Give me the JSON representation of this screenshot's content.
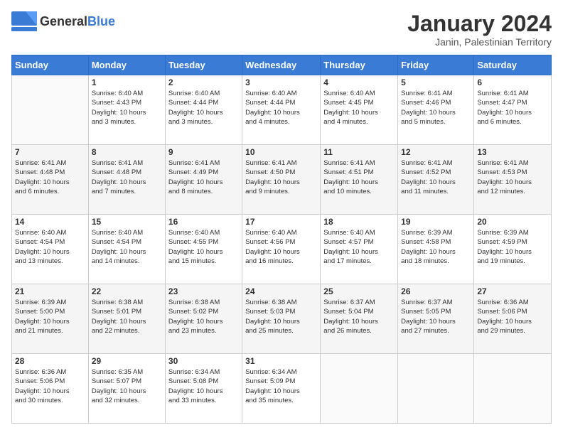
{
  "header": {
    "logo_general": "General",
    "logo_blue": "Blue",
    "title": "January 2024",
    "subtitle": "Janin, Palestinian Territory"
  },
  "days_of_week": [
    "Sunday",
    "Monday",
    "Tuesday",
    "Wednesday",
    "Thursday",
    "Friday",
    "Saturday"
  ],
  "weeks": [
    [
      {
        "day": "",
        "info": ""
      },
      {
        "day": "1",
        "info": "Sunrise: 6:40 AM\nSunset: 4:43 PM\nDaylight: 10 hours\nand 3 minutes."
      },
      {
        "day": "2",
        "info": "Sunrise: 6:40 AM\nSunset: 4:44 PM\nDaylight: 10 hours\nand 3 minutes."
      },
      {
        "day": "3",
        "info": "Sunrise: 6:40 AM\nSunset: 4:44 PM\nDaylight: 10 hours\nand 4 minutes."
      },
      {
        "day": "4",
        "info": "Sunrise: 6:40 AM\nSunset: 4:45 PM\nDaylight: 10 hours\nand 4 minutes."
      },
      {
        "day": "5",
        "info": "Sunrise: 6:41 AM\nSunset: 4:46 PM\nDaylight: 10 hours\nand 5 minutes."
      },
      {
        "day": "6",
        "info": "Sunrise: 6:41 AM\nSunset: 4:47 PM\nDaylight: 10 hours\nand 6 minutes."
      }
    ],
    [
      {
        "day": "7",
        "info": "Sunrise: 6:41 AM\nSunset: 4:48 PM\nDaylight: 10 hours\nand 6 minutes."
      },
      {
        "day": "8",
        "info": "Sunrise: 6:41 AM\nSunset: 4:48 PM\nDaylight: 10 hours\nand 7 minutes."
      },
      {
        "day": "9",
        "info": "Sunrise: 6:41 AM\nSunset: 4:49 PM\nDaylight: 10 hours\nand 8 minutes."
      },
      {
        "day": "10",
        "info": "Sunrise: 6:41 AM\nSunset: 4:50 PM\nDaylight: 10 hours\nand 9 minutes."
      },
      {
        "day": "11",
        "info": "Sunrise: 6:41 AM\nSunset: 4:51 PM\nDaylight: 10 hours\nand 10 minutes."
      },
      {
        "day": "12",
        "info": "Sunrise: 6:41 AM\nSunset: 4:52 PM\nDaylight: 10 hours\nand 11 minutes."
      },
      {
        "day": "13",
        "info": "Sunrise: 6:41 AM\nSunset: 4:53 PM\nDaylight: 10 hours\nand 12 minutes."
      }
    ],
    [
      {
        "day": "14",
        "info": "Sunrise: 6:40 AM\nSunset: 4:54 PM\nDaylight: 10 hours\nand 13 minutes."
      },
      {
        "day": "15",
        "info": "Sunrise: 6:40 AM\nSunset: 4:54 PM\nDaylight: 10 hours\nand 14 minutes."
      },
      {
        "day": "16",
        "info": "Sunrise: 6:40 AM\nSunset: 4:55 PM\nDaylight: 10 hours\nand 15 minutes."
      },
      {
        "day": "17",
        "info": "Sunrise: 6:40 AM\nSunset: 4:56 PM\nDaylight: 10 hours\nand 16 minutes."
      },
      {
        "day": "18",
        "info": "Sunrise: 6:40 AM\nSunset: 4:57 PM\nDaylight: 10 hours\nand 17 minutes."
      },
      {
        "day": "19",
        "info": "Sunrise: 6:39 AM\nSunset: 4:58 PM\nDaylight: 10 hours\nand 18 minutes."
      },
      {
        "day": "20",
        "info": "Sunrise: 6:39 AM\nSunset: 4:59 PM\nDaylight: 10 hours\nand 19 minutes."
      }
    ],
    [
      {
        "day": "21",
        "info": "Sunrise: 6:39 AM\nSunset: 5:00 PM\nDaylight: 10 hours\nand 21 minutes."
      },
      {
        "day": "22",
        "info": "Sunrise: 6:38 AM\nSunset: 5:01 PM\nDaylight: 10 hours\nand 22 minutes."
      },
      {
        "day": "23",
        "info": "Sunrise: 6:38 AM\nSunset: 5:02 PM\nDaylight: 10 hours\nand 23 minutes."
      },
      {
        "day": "24",
        "info": "Sunrise: 6:38 AM\nSunset: 5:03 PM\nDaylight: 10 hours\nand 25 minutes."
      },
      {
        "day": "25",
        "info": "Sunrise: 6:37 AM\nSunset: 5:04 PM\nDaylight: 10 hours\nand 26 minutes."
      },
      {
        "day": "26",
        "info": "Sunrise: 6:37 AM\nSunset: 5:05 PM\nDaylight: 10 hours\nand 27 minutes."
      },
      {
        "day": "27",
        "info": "Sunrise: 6:36 AM\nSunset: 5:06 PM\nDaylight: 10 hours\nand 29 minutes."
      }
    ],
    [
      {
        "day": "28",
        "info": "Sunrise: 6:36 AM\nSunset: 5:06 PM\nDaylight: 10 hours\nand 30 minutes."
      },
      {
        "day": "29",
        "info": "Sunrise: 6:35 AM\nSunset: 5:07 PM\nDaylight: 10 hours\nand 32 minutes."
      },
      {
        "day": "30",
        "info": "Sunrise: 6:34 AM\nSunset: 5:08 PM\nDaylight: 10 hours\nand 33 minutes."
      },
      {
        "day": "31",
        "info": "Sunrise: 6:34 AM\nSunset: 5:09 PM\nDaylight: 10 hours\nand 35 minutes."
      },
      {
        "day": "",
        "info": ""
      },
      {
        "day": "",
        "info": ""
      },
      {
        "day": "",
        "info": ""
      }
    ]
  ]
}
